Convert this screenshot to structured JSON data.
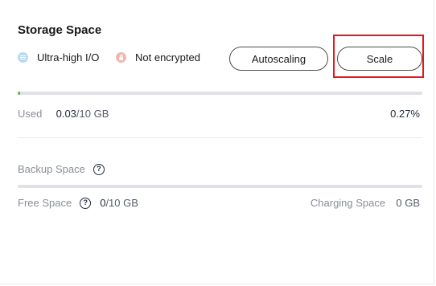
{
  "storage": {
    "title": "Storage Space",
    "tags": {
      "io_label": "Ultra-high I/O",
      "encryption_label": "Not encrypted"
    },
    "buttons": {
      "autoscaling": "Autoscaling",
      "scale": "Scale"
    },
    "used": {
      "label": "Used",
      "value": "0.03",
      "total": "/10 GB",
      "percent_text": "0.27%",
      "fraction": 0.0027
    }
  },
  "backup": {
    "title": "Backup Space",
    "free_label": "Free Space",
    "free_value": "0",
    "free_total": "/10 GB",
    "charging_label": "Charging Space",
    "charging_value": "0 GB"
  },
  "colors": {
    "accent_green": "#5bbd3a",
    "highlight_red": "#e8151b",
    "io_icon": "#b8d9f0",
    "lock_icon": "#f1b7ae"
  },
  "icons": {
    "io": "ultra-high-io-icon",
    "lock": "lock-icon",
    "help": "help-circle-icon"
  }
}
